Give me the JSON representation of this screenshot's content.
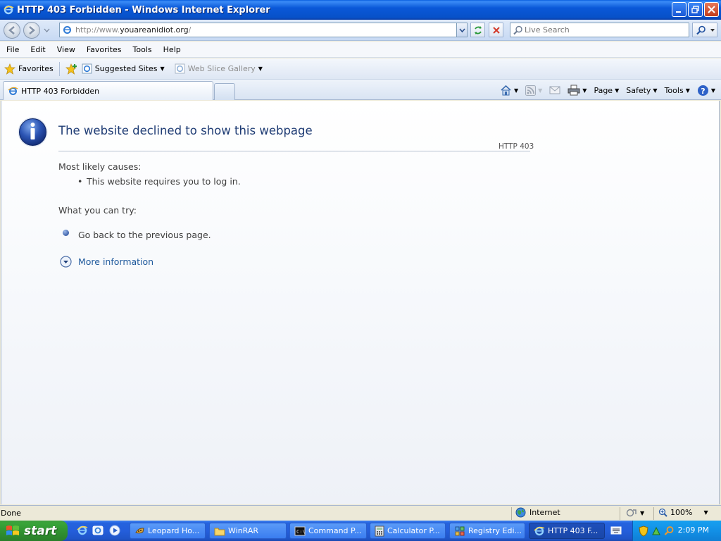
{
  "window": {
    "title": "HTTP 403 Forbidden - Windows Internet Explorer"
  },
  "address": {
    "scheme": "http://www.",
    "domain": "youareanidiot.org",
    "tail": "/"
  },
  "search": {
    "placeholder": "Live Search"
  },
  "menu": [
    "File",
    "Edit",
    "View",
    "Favorites",
    "Tools",
    "Help"
  ],
  "favorites_bar": {
    "favorites_label": "Favorites",
    "suggested_sites": "Suggested Sites",
    "web_slice_gallery": "Web Slice Gallery"
  },
  "tab": {
    "title": "HTTP 403 Forbidden"
  },
  "command_bar": {
    "page": "Page",
    "safety": "Safety",
    "tools": "Tools"
  },
  "page": {
    "title": "The website declined to show this webpage",
    "code": "HTTP 403",
    "causes_heading": "Most likely causes:",
    "causes": [
      "This website requires you to log in."
    ],
    "try_heading": "What you can try:",
    "try_items": [
      "Go back to the previous page."
    ],
    "more_info": "More information"
  },
  "status": {
    "text": "Done",
    "zone": "Internet",
    "zoom": "100%"
  },
  "taskbar": {
    "start": "start",
    "tasks": [
      "Leopard Ho...",
      "WinRAR",
      "Command P...",
      "Calculator P...",
      "Registry Edi...",
      "HTTP 403 F..."
    ],
    "clock": "2:09 PM"
  },
  "colors": {
    "title_blue": "#0a58d8",
    "heading_blue": "#1f3c74",
    "link_blue": "#1f5a9c",
    "start_green": "#2f8f2f"
  }
}
